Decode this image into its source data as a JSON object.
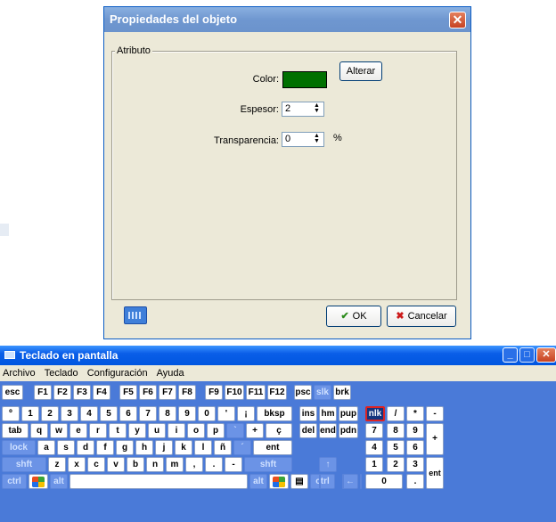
{
  "dialog": {
    "title": "Propiedades del objeto",
    "close_glyph": "✕",
    "group_label": "Atributo",
    "color_label": "Color:",
    "color_value": "#007000",
    "alter_button": "Alterar",
    "thickness_label": "Espesor:",
    "thickness_value": "2",
    "transparency_label": "Transparencia:",
    "transparency_value": "0",
    "percent_sign": "%",
    "ok_button": "OK",
    "cancel_button": "Cancelar",
    "ok_icon": "check-icon",
    "cancel_icon": "x-icon"
  },
  "osk": {
    "title": "Teclado en pantalla",
    "menu": [
      "Archivo",
      "Teclado",
      "Configuración",
      "Ayuda"
    ],
    "rows": [
      [
        "esc",
        "F1",
        "F2",
        "F3",
        "F4",
        "F5",
        "F6",
        "F7",
        "F8",
        "F9",
        "F10",
        "F11",
        "F12",
        "psc",
        "slk",
        "brk"
      ],
      [
        "º",
        "1",
        "2",
        "3",
        "4",
        "5",
        "6",
        "7",
        "8",
        "9",
        "0",
        "'",
        "¡",
        "bksp",
        "ins",
        "hm",
        "pup",
        "nlk",
        "/",
        "*",
        "-"
      ],
      [
        "tab",
        "q",
        "w",
        "e",
        "r",
        "t",
        "y",
        "u",
        "i",
        "o",
        "p",
        "`",
        "+",
        "ç",
        "del",
        "end",
        "pdn",
        "7",
        "8",
        "9",
        "+"
      ],
      [
        "lock",
        "a",
        "s",
        "d",
        "f",
        "g",
        "h",
        "j",
        "k",
        "l",
        "ñ",
        "´",
        "ent",
        "4",
        "5",
        "6"
      ],
      [
        "shft",
        "z",
        "x",
        "c",
        "v",
        "b",
        "n",
        "m",
        ",",
        ".",
        "-",
        "shft",
        "↑",
        "1",
        "2",
        "3",
        "ent"
      ],
      [
        "ctrl",
        "alt",
        "alt",
        "ctrl",
        "←",
        "↓",
        "→",
        "0",
        "."
      ]
    ]
  },
  "colors": {
    "title_blue": "#0a5ee8",
    "dialog_bg": "#ece9d8",
    "key_area": "#4a7ad8",
    "swatch_green": "#007000"
  }
}
